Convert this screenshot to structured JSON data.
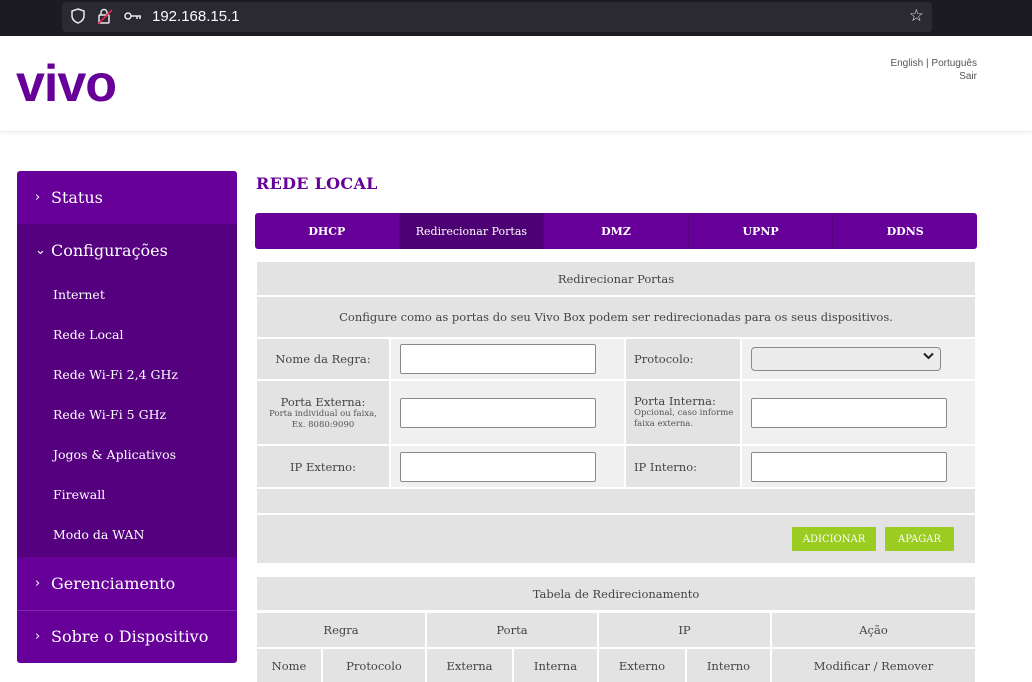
{
  "browser": {
    "url": "192.168.15.1"
  },
  "header": {
    "logo_text": "vivo",
    "lang_en": "English",
    "lang_sep": " | ",
    "lang_pt": "Português",
    "logout": "Sair",
    "brand_color": "#660099"
  },
  "sidebar": {
    "status": "Status",
    "config": "Configurações",
    "items": [
      "Internet",
      "Rede Local",
      "Rede Wi-Fi 2,4 GHz",
      "Rede Wi-Fi 5 GHz",
      "Jogos & Aplicativos",
      "Firewall",
      "Modo da WAN"
    ],
    "management": "Gerenciamento",
    "about": "Sobre o Dispositivo"
  },
  "main": {
    "title": "REDE LOCAL",
    "tabs": [
      "DHCP",
      "Redirecionar Portas",
      "DMZ",
      "UPNP",
      "DDNS"
    ],
    "section_title": "Redirecionar Portas",
    "description": "Configure como as portas do seu Vivo Box podem ser redirecionadas para os seus dispositivos.",
    "form": {
      "rule_name_label": "Nome da Regra:",
      "protocol_label": "Protocolo:",
      "ext_port_label": "Porta Externa:",
      "ext_port_hint1": "Porta individual ou faixa,",
      "ext_port_hint2": "Ex. 8080:9090",
      "int_port_label": "Porta Interna:",
      "int_port_hint1": "Opcional, caso informe",
      "int_port_hint2": "faixa externa.",
      "ext_ip_label": "IP Externo:",
      "int_ip_label": "IP Interno:",
      "rule_name_value": "",
      "ext_port_value": "",
      "int_port_value": "",
      "ext_ip_value": "",
      "int_ip_value": "",
      "protocol_value": ""
    },
    "add_button": "ADICIONAR",
    "delete_button": "APAGAR",
    "button_color": "#9bcc21",
    "table": {
      "title": "Tabela de Redirecionamento",
      "group_headers": [
        "Regra",
        "Porta",
        "IP",
        "Ação"
      ],
      "sub_headers": [
        "Nome",
        "Protocolo",
        "Externa",
        "Interna",
        "Externo",
        "Interno",
        "Modificar / Remover"
      ]
    }
  }
}
